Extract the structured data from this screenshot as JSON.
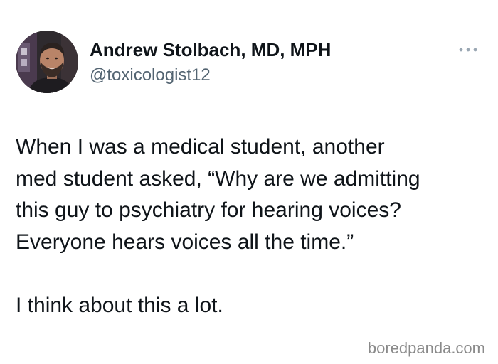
{
  "tweet": {
    "author": {
      "display_name": "Andrew Stolbach, MD, MPH",
      "handle": "@toxicologist12",
      "avatar_icon": "profile-photo"
    },
    "more_icon": "ellipsis-icon",
    "text_lines_paragraph_1": [
      "When I was a medical student, another",
      "med student asked, “Why are we admitting",
      "this guy to psychiatry for hearing voices?",
      "Everyone hears voices all the time.”"
    ],
    "text_paragraph_2": "I think about this a lot."
  },
  "watermark": {
    "text": "boredpanda.com"
  },
  "colors": {
    "name": "#0f1419",
    "handle": "#536471",
    "body": "#0f1419",
    "watermark": "#8a8a8a",
    "more_dots": "#9aa7b3"
  }
}
